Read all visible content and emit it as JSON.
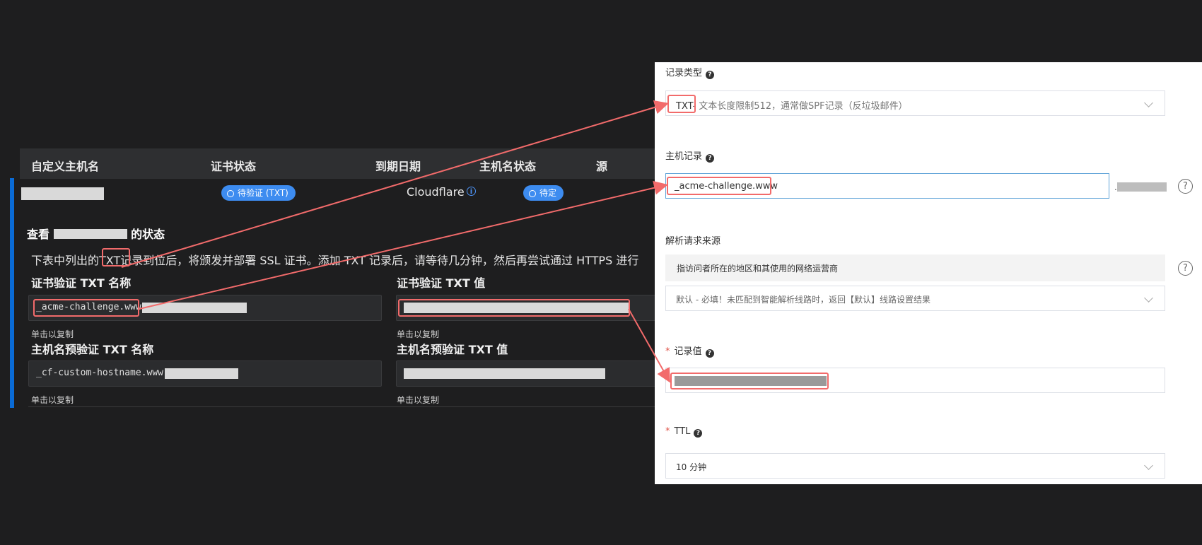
{
  "table": {
    "headers": [
      "自定义主机名",
      "证书状态",
      "到期日期",
      "主机名状态",
      "源"
    ],
    "row": {
      "cert_status": "待验证 (TXT)",
      "expiry": "Cloudflare",
      "hostname_status": "待定"
    }
  },
  "details": {
    "title_prefix": "查看",
    "title_suffix": "的状态",
    "description_a": "下表中列出的",
    "description_txt": "TXT",
    "description_b": "记录到位后，将颁发并部署 SSL 证书。添加 TXT 记录后，请等待几分钟，然后再尝试通过 HTTPS 进行",
    "cert_txt_name_label": "证书验证 TXT 名称",
    "cert_txt_name_value": "_acme-challenge.www.",
    "cert_txt_value_label": "证书验证 TXT 值",
    "host_txt_name_label": "主机名预验证 TXT 名称",
    "host_txt_name_value": "_cf-custom-hostname.www.",
    "host_txt_value_label": "主机名预验证 TXT 值",
    "copy_hint": "单击以复制"
  },
  "form": {
    "record_type_label": "记录类型",
    "record_type_value": "TXT",
    "record_type_desc": "- 文本长度限制512，通常做SPF记录（反垃圾邮件）",
    "host_label": "主机记录",
    "host_value": "_acme-challenge.www",
    "host_suffix": ".",
    "resolve_source_label": "解析请求来源",
    "resolve_source_note": "指访问者所在的地区和其使用的网络运营商",
    "resolve_source_value": "默认 - 必填！未匹配到智能解析线路时，返回【默认】线路设置结果",
    "record_value_label": "记录值",
    "ttl_label": "TTL",
    "ttl_value": "10 分钟",
    "help_glyph": "?",
    "required_mark": "*"
  },
  "colors": {
    "accent_blue": "#3d8cf0",
    "annotation_red": "#f26b6b",
    "dark_bg": "#1e1e1f",
    "row_accent": "#0a6bd6"
  },
  "icons": {
    "status_icon": "clock-icon",
    "info_icon": "info-icon",
    "help_icon": "question-circle-icon",
    "dropdown_icon": "chevron-down-icon"
  }
}
